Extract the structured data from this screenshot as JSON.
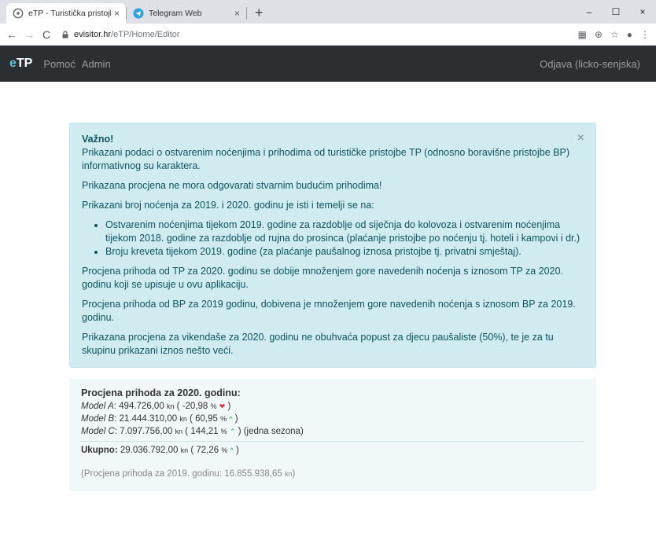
{
  "browser": {
    "tabs": [
      {
        "title": "eTP - Turistička pristojba",
        "close": "×"
      },
      {
        "title": "Telegram Web",
        "close": "×"
      }
    ],
    "new_tab": "+",
    "window_controls": {
      "minimize": "–",
      "maximize": "☐",
      "close": "×"
    },
    "url_host": "evisitor.hr",
    "url_path": "/eTP/Home/Editor"
  },
  "navbar": {
    "brand_e": "e",
    "brand_rest": "TP",
    "links": [
      "Pomoć",
      "Admin"
    ],
    "logout": "Odjava (licko-senjska)"
  },
  "alert": {
    "title": "Važno!",
    "close": "×",
    "intro": "Prikazani podaci o ostvarenim noćenjima i prihodima od turističke pristojbe TP (odnosno boravišne pristojbe BP) informativnog su karaktera.",
    "p2": "Prikazana procjena ne mora odgovarati stvarnim budućim prihodima!",
    "p3": "Prikazani broj noćenja za 2019. i 2020. godinu je isti i temelji se na:",
    "bullets": [
      "Ostvarenim noćenjima tijekom 2019. godine za razdoblje od siječnja do kolovoza i ostvarenim noćenjima tijekom 2018. godine za razdoblje od rujna do prosinca (plaćanje pristojbe po noćenju tj. hoteli i kampovi i dr.)",
      "Broju kreveta tijekom 2019. godine (za plaćanje paušalnog iznosa pristojbe tj. privatni smještaj)."
    ],
    "p4": "Procjena prihoda od TP za 2020. godinu se dobije množenjem gore navedenih noćenja s iznosom TP za 2020. godinu koji se upisuje u ovu aplikaciju.",
    "p5": "Procjena prihoda od BP za 2019 godinu, dobivena je množenjem gore navedenih noćenja s iznosom BP za 2019. godinu.",
    "p6": "Prikazana procjena za vikendaše za 2020. godinu ne obuhvaća popust za djecu paušaliste (50%), te je za tu skupinu prikazani iznos nešto veći."
  },
  "estimate": {
    "heading": "Procjena prihoda za 2020. godinu:",
    "unit": "kn",
    "pct": "%",
    "models": [
      {
        "name": "Model A",
        "amount": "494.726,00",
        "change": "-20,98",
        "trend": "down",
        "arrow": "❤",
        "suffix": ")"
      },
      {
        "name": "Model B",
        "amount": "21.444.310,00",
        "change": "60,95",
        "trend": "up",
        "arrow": "^",
        "suffix": ")"
      },
      {
        "name": "Model C",
        "amount": "7.097.756,00",
        "change": "144,21",
        "trend": "up",
        "arrow": "⌃",
        "suffix": ") (jedna sezona)"
      }
    ],
    "total_label": "Ukupno",
    "total_amount": "29.036.792,00",
    "total_change": "72,26",
    "total_arrow": "^",
    "prev_label": "(Procjena prihoda za 2019. godinu: 16.855.938,65",
    "prev_unit": "kn",
    "prev_close": ")"
  }
}
